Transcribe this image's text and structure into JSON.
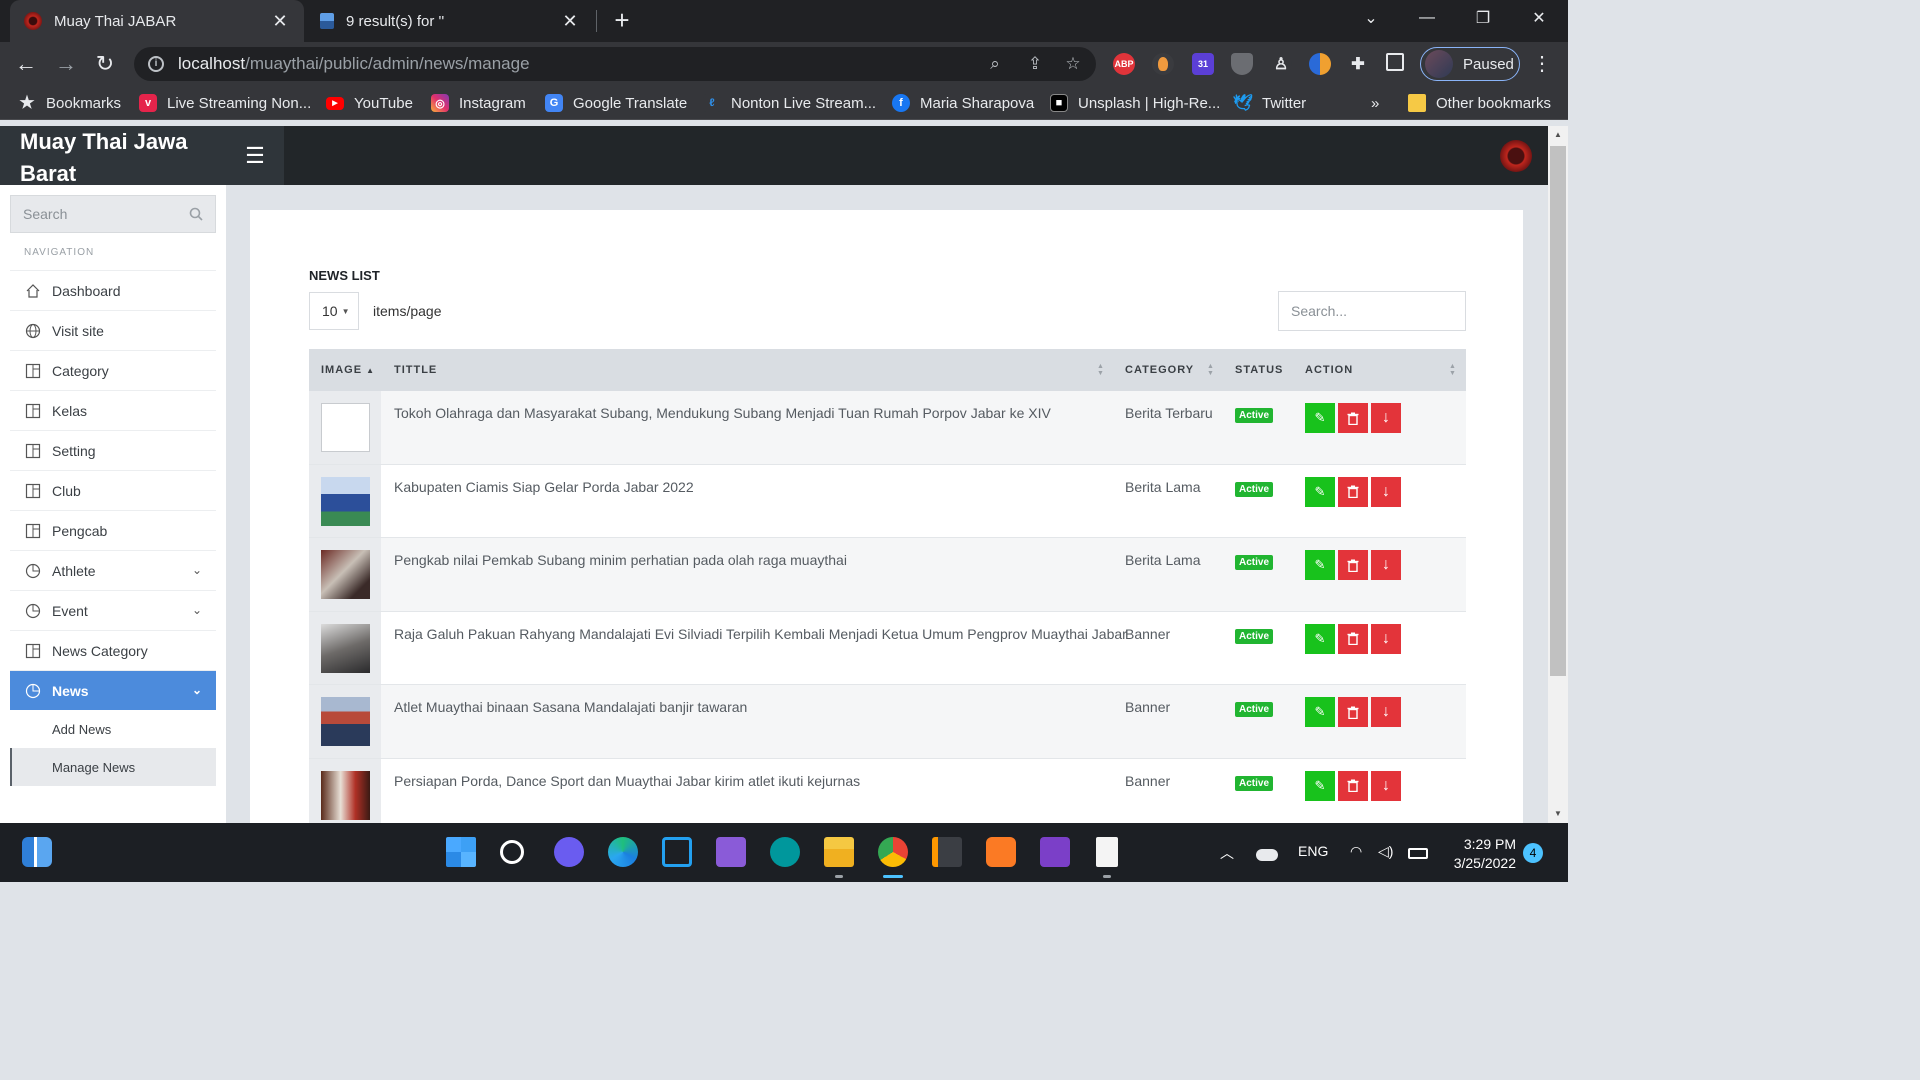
{
  "browser": {
    "tabs": [
      {
        "title": "Muay Thai JABAR",
        "active": true
      },
      {
        "title": "9 result(s) for ''",
        "active": false
      }
    ],
    "url_host": "localhost",
    "url_path": "/muaythai/public/admin/news/manage",
    "profile_label": "Paused",
    "extension_badge": "31",
    "abp_label": "ABP",
    "bookmarks": [
      {
        "label": "Bookmarks",
        "icon": "star-icon"
      },
      {
        "label": "Live Streaming Non...",
        "icon": "vidio-icon"
      },
      {
        "label": "YouTube",
        "icon": "youtube-icon"
      },
      {
        "label": "Instagram",
        "icon": "instagram-icon"
      },
      {
        "label": "Google Translate",
        "icon": "google-translate-icon"
      },
      {
        "label": "Nonton Live Stream...",
        "icon": "stream-icon"
      },
      {
        "label": "Maria Sharapova",
        "icon": "facebook-icon"
      },
      {
        "label": "Unsplash | High-Re...",
        "icon": "unsplash-icon"
      },
      {
        "label": "Twitter",
        "icon": "twitter-icon"
      }
    ],
    "bookmarks_overflow": "»",
    "other_bookmarks": "Other bookmarks"
  },
  "app": {
    "brand": "Muay Thai Jawa Barat",
    "sidebar": {
      "search_placeholder": "Search",
      "nav_header": "NAVIGATION",
      "items": [
        {
          "label": "Dashboard",
          "icon": "home-icon",
          "expandable": false
        },
        {
          "label": "Visit site",
          "icon": "globe-icon",
          "expandable": false
        },
        {
          "label": "Category",
          "icon": "layout-icon",
          "expandable": false
        },
        {
          "label": "Kelas",
          "icon": "layout-icon",
          "expandable": false
        },
        {
          "label": "Setting",
          "icon": "layout-icon",
          "expandable": false
        },
        {
          "label": "Club",
          "icon": "layout-icon",
          "expandable": false
        },
        {
          "label": "Pengcab",
          "icon": "layout-icon",
          "expandable": false
        },
        {
          "label": "Athlete",
          "icon": "pie-chart-icon",
          "expandable": true
        },
        {
          "label": "Event",
          "icon": "pie-chart-icon",
          "expandable": true
        },
        {
          "label": "News Category",
          "icon": "layout-icon",
          "expandable": false
        },
        {
          "label": "News",
          "icon": "pie-chart-icon",
          "expandable": true,
          "active": true
        }
      ],
      "sub_items": [
        {
          "label": "Add News",
          "current": false
        },
        {
          "label": "Manage News",
          "current": true
        }
      ]
    },
    "content": {
      "title": "NEWS LIST",
      "per_page_value": "10",
      "per_page_label": "items/page",
      "search_placeholder": "Search...",
      "columns": [
        "IMAGE",
        "TITTLE",
        "CATEGORY",
        "STATUS",
        "ACTION"
      ],
      "rows": [
        {
          "title": "Tokoh Olahraga dan Masyarakat Subang, Mendukung Subang Menjadi Tuan Rumah Porpov Jabar ke XIV",
          "category": "Berita Terbaru",
          "status": "Active",
          "image": "broken"
        },
        {
          "title": "Kabupaten Ciamis Siap Gelar Porda Jabar 2022",
          "category": "Berita Lama",
          "status": "Active",
          "image": "photo-blue"
        },
        {
          "title": "Pengkab nilai Pemkab Subang minim perhatian pada olah raga muaythai",
          "category": "Berita Lama",
          "status": "Active",
          "image": "photo-red"
        },
        {
          "title": "Raja Galuh Pakuan Rahyang Mandalajati Evi Silviadi Terpilih Kembali Menjadi Ketua Umum Pengprov Muaythai Jabar",
          "category": "Banner",
          "status": "Active",
          "image": "photo-grey"
        },
        {
          "title": "Atlet Muaythai binaan Sasana Mandalajati banjir tawaran",
          "category": "Banner",
          "status": "Active",
          "image": "photo-crowd"
        },
        {
          "title": "Persiapan Porda, Dance Sport dan Muaythai Jabar kirim atlet ikuti kejurnas",
          "category": "Banner",
          "status": "Active",
          "image": "photo-ceremony"
        }
      ]
    }
  },
  "taskbar": {
    "language": "ENG",
    "time": "3:29 PM",
    "date": "3/25/2022",
    "notifications": "4"
  },
  "colors": {
    "sidebar_active": "#4c8bdc",
    "status_active": "#21b531",
    "edit_button": "#18c21c",
    "delete_button": "#e3343a"
  }
}
